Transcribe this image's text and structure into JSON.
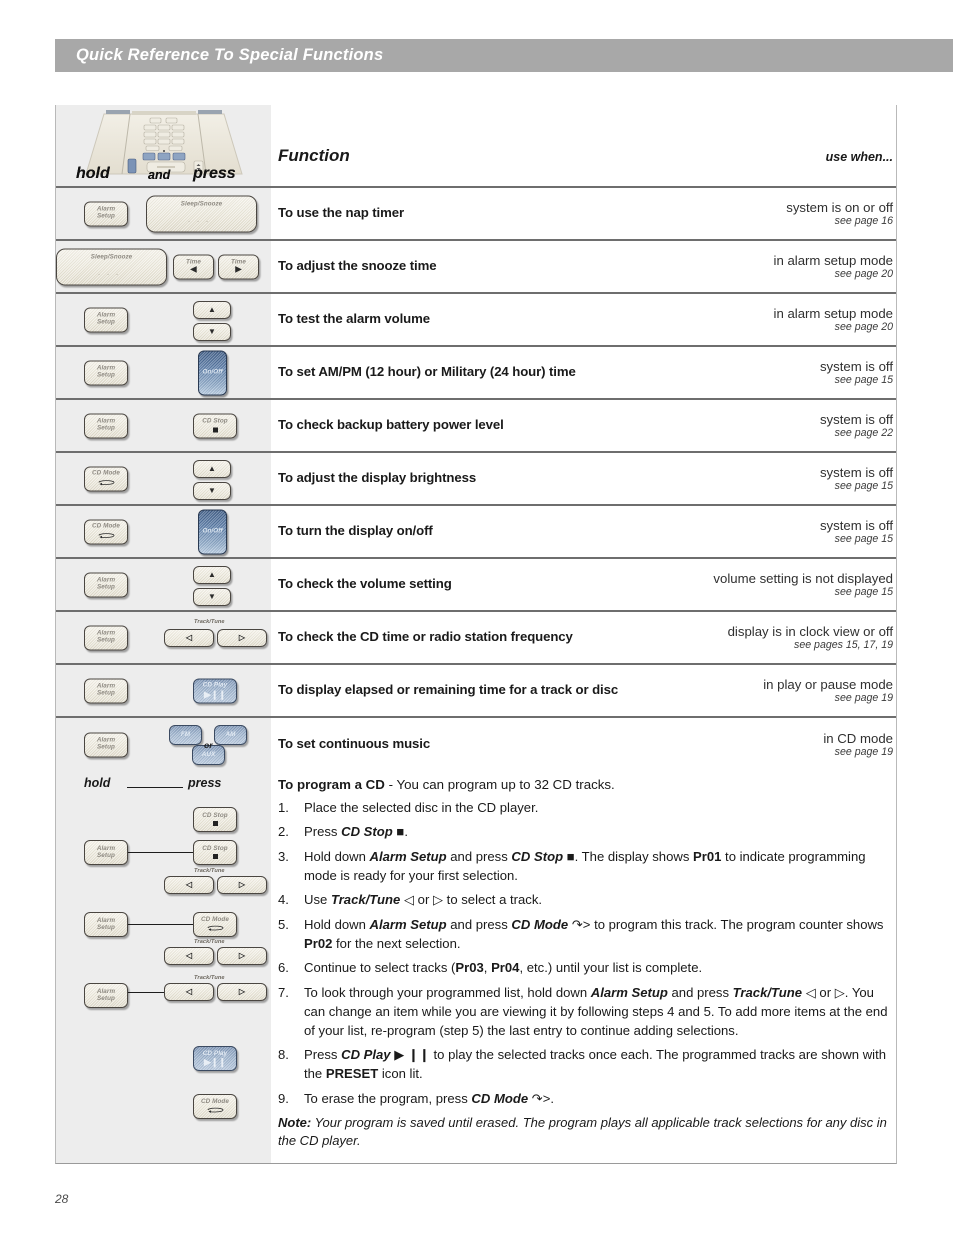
{
  "header": {
    "title": "Quick Reference To Special Functions"
  },
  "column_heads": {
    "hold": "hold",
    "and": "and",
    "press": "press",
    "function": "Function",
    "use_when": "use when..."
  },
  "rows": [
    {
      "hold_key": {
        "label": "Alarm Setup",
        "type": "small"
      },
      "press_keys": [
        {
          "label": "Sleep/Snooze",
          "type": "wide-bar"
        }
      ],
      "function": "To use the nap timer",
      "when": "system is on or off",
      "page": "see page 16"
    },
    {
      "hold_key": {
        "label": "Sleep/Snooze",
        "type": "wide-bar"
      },
      "press_keys": [
        {
          "label": "Time",
          "type": "arrow-left"
        },
        {
          "label": "Time",
          "type": "arrow-right"
        }
      ],
      "function": "To adjust the snooze time",
      "when": "in alarm setup mode",
      "page": "see page 20"
    },
    {
      "hold_key": {
        "label": "Alarm Setup",
        "type": "small"
      },
      "press_keys": [
        {
          "label": "up",
          "type": "up"
        },
        {
          "label": "down",
          "type": "down"
        }
      ],
      "function": "To test the alarm volume",
      "when": "in alarm setup mode",
      "page": "see page 20"
    },
    {
      "hold_key": {
        "label": "Alarm Setup",
        "type": "small"
      },
      "press_keys": [
        {
          "label": "On/Off",
          "type": "onoff"
        }
      ],
      "function": "To set AM/PM (12 hour) or Military (24 hour) time",
      "when": "system is off",
      "page": "see page 15"
    },
    {
      "hold_key": {
        "label": "Alarm Setup",
        "type": "small"
      },
      "press_keys": [
        {
          "label": "CD Stop",
          "type": "cdstop"
        }
      ],
      "function": "To check backup battery power level",
      "when": "system is off",
      "page": "see page 22"
    },
    {
      "hold_key": {
        "label": "CD Mode",
        "type": "cdmode"
      },
      "press_keys": [
        {
          "label": "up",
          "type": "up"
        },
        {
          "label": "down",
          "type": "down"
        }
      ],
      "function": "To adjust the display brightness",
      "when": "system is off",
      "page": "see page 15"
    },
    {
      "hold_key": {
        "label": "CD Mode",
        "type": "cdmode"
      },
      "press_keys": [
        {
          "label": "On/Off",
          "type": "onoff"
        }
      ],
      "function": "To turn the display on/off",
      "when": "system is off",
      "page": "see page 15"
    },
    {
      "hold_key": {
        "label": "Alarm Setup",
        "type": "small"
      },
      "press_keys": [
        {
          "label": "up",
          "type": "up"
        },
        {
          "label": "down",
          "type": "down"
        }
      ],
      "function": "To check the volume setting",
      "when": "volume setting is not displayed",
      "page": "see page 15"
    },
    {
      "hold_key": {
        "label": "Alarm Setup",
        "type": "small"
      },
      "press_keys": [
        {
          "label": "Track/Tune",
          "type": "tt-left"
        },
        {
          "label": "Track/Tune",
          "type": "tt-right"
        }
      ],
      "function": "To check the CD time or radio station frequency",
      "when": "display is in clock view or off",
      "page": "see pages 15, 17, 19"
    },
    {
      "hold_key": {
        "label": "Alarm Setup",
        "type": "small"
      },
      "press_keys": [
        {
          "label": "CD Play",
          "type": "cdplay"
        }
      ],
      "function": "To display elapsed or remaining time for a track or disc",
      "when": "in play or pause mode",
      "page": "see page 19"
    },
    {
      "hold_key": {
        "label": "Alarm Setup",
        "type": "small"
      },
      "press_keys": [
        {
          "label": "FM",
          "type": "src"
        },
        {
          "label": "AM",
          "type": "src"
        },
        {
          "label": "AUX",
          "type": "src"
        }
      ],
      "or_text": "or",
      "function": "To set continuous music",
      "when": "in CD mode",
      "page": "see page 19"
    }
  ],
  "program": {
    "hold": "hold",
    "press": "press",
    "title_bold": "To program a CD",
    "title_rest": " - You can program up to 32 CD tracks.",
    "keys": [
      {
        "label": "CD Stop",
        "type": "cdstop"
      },
      {
        "label": "Alarm Setup",
        "type": "small"
      },
      {
        "label": "CD Stop",
        "type": "cdstop"
      },
      {
        "label": "Track/Tune",
        "type": "tt-pair"
      },
      {
        "label": "Alarm Setup",
        "type": "small"
      },
      {
        "label": "CD Mode",
        "type": "cdmode"
      },
      {
        "label": "Track/Tune",
        "type": "tt-pair"
      },
      {
        "label": "Alarm Setup",
        "type": "small"
      },
      {
        "label": "Track/Tune",
        "type": "tt-pair"
      },
      {
        "label": "CD Play",
        "type": "cdplay"
      },
      {
        "label": "CD Mode",
        "type": "cdmode"
      }
    ],
    "steps": [
      {
        "num": "1.",
        "html": "Place the selected disc in the CD player."
      },
      {
        "num": "2.",
        "html": "Press <span class=\"bi\">CD Stop</span> <span class=\"gl\">&#9632;</span>."
      },
      {
        "num": "3.",
        "html": "Hold down <span class=\"bi\">Alarm Setup</span> and press <span class=\"bi\">CD Stop</span> <span class=\"gl\">&#9632;</span>. The display shows <span class=\"bb\">Pr01</span> to indicate programming mode is ready for your first selection."
      },
      {
        "num": "4.",
        "html": "Use <span class=\"bi\">Track/Tune</span> <span class=\"gl\">&#9665;</span> or <span class=\"gl\">&#9655;</span> to select a track."
      },
      {
        "num": "5.",
        "html": "Hold down <span class=\"bi\">Alarm Setup</span> and press <span class=\"bi\">CD Mode</span> <span class=\"gl\">&#8631;&#62;</span> to program this track. The program counter shows <span class=\"bb\">Pr02</span> for the next selection."
      },
      {
        "num": "6.",
        "html": "Continue to select tracks (<span class=\"bb\">Pr03</span>, <span class=\"bb\">Pr04</span>, etc.) until your list is complete."
      },
      {
        "num": "7.",
        "html": "To look through your programmed list, hold down <span class=\"bi\">Alarm Setup</span> and press <span class=\"bi\">Track/Tune</span> <span class=\"gl\">&#9665;</span> or <span class=\"gl\">&#9655;</span>. You can change an item while you are viewing it by following steps 4 and 5. To add more items at the end of your list, re-program (step 5) the last entry to continue adding selections."
      },
      {
        "num": "8.",
        "html": "Press <span class=\"bi\">CD Play</span> <span class=\"gl\">&#9654; &#10073;&#10073;</span> to play the selected tracks once each. The programmed tracks are shown with the <span class=\"bb\">PRESET</span> icon lit."
      },
      {
        "num": "9.",
        "html": "To erase the program, press <span class=\"bi\">CD Mode</span> <span class=\"gl\">&#8631;&#62;</span>."
      }
    ],
    "note_label": "Note:",
    "note_text": " Your program is saved until erased. The program plays all applicable track selections for any disc in the CD player."
  },
  "page_number": "28",
  "colors": {
    "header_bar": "#a8a8a8",
    "key_column_bg": "#ededed",
    "row_rule": "#6e6e6e",
    "blue_button": "#5a7ba6"
  }
}
